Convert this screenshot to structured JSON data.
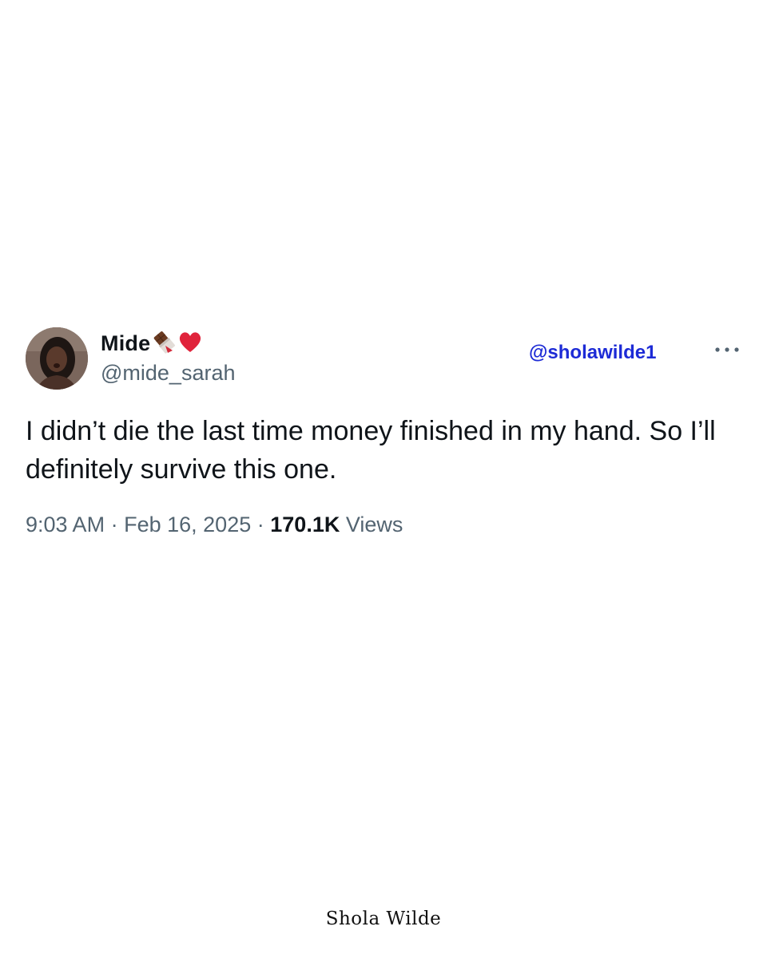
{
  "tweet": {
    "author": {
      "display_name": "Mide",
      "name_emojis": [
        "chocolate-bar-icon",
        "red-heart-icon"
      ],
      "handle": "@mide_sarah"
    },
    "watermark_handle": "@sholawilde1",
    "text": "I didn’t die the last time money finished in my hand. So I’ll definitely survive this one.",
    "time": "9:03 AM",
    "separator": "·",
    "date": "Feb 16, 2025",
    "views_count": "170.1K",
    "views_label": "Views",
    "more_icon": "more-horizontal-icon"
  },
  "footer": {
    "signature": "Shola Wilde"
  },
  "colors": {
    "text_primary": "#0f1419",
    "text_secondary": "#536471",
    "watermark_blue": "#1d2bd6",
    "heart_red": "#e0233b",
    "background": "#ffffff"
  }
}
